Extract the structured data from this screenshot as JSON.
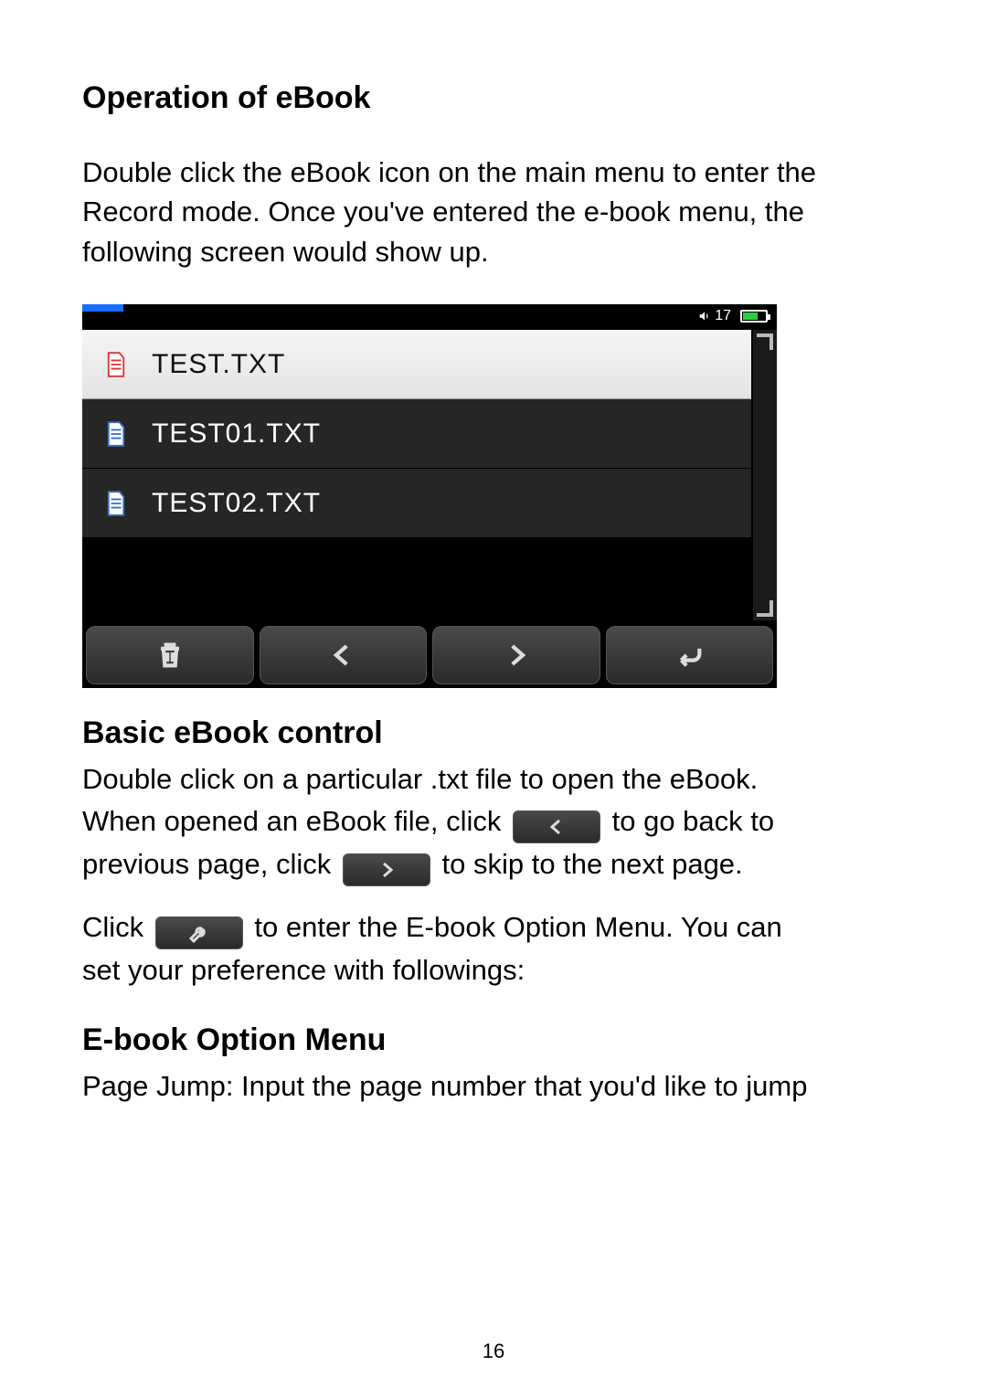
{
  "doc": {
    "heading_main": "Operation of eBook",
    "para_intro": "Double click the eBook icon on the main menu to enter the Record mode. Once you've entered the e-book menu, the following screen would show up.",
    "heading_basic": "Basic eBook control",
    "basic_line1": "Double click on a particular .txt file to open the eBook.",
    "basic_line2a": "When opened an eBook file, click ",
    "basic_line2b": " to go back to",
    "basic_line3a": "previous page, click ",
    "basic_line3b": " to skip to the next page.",
    "basic_line4a": "Click ",
    "basic_line4b": " to enter the E-book Option Menu. You can",
    "basic_line5": "set your preference with followings:",
    "heading_option": "E-book Option Menu",
    "option_line1": "Page Jump: Input the page number that you'd like to jump",
    "page_number": "16"
  },
  "screenshot": {
    "status": {
      "volume": "17"
    },
    "files": [
      {
        "name": "TEST.TXT",
        "selected": true
      },
      {
        "name": "TEST01.TXT",
        "selected": false
      },
      {
        "name": "TEST02.TXT",
        "selected": false
      }
    ],
    "toolbar_icons": [
      "trash-icon",
      "previous-icon",
      "next-icon",
      "return-icon"
    ]
  }
}
